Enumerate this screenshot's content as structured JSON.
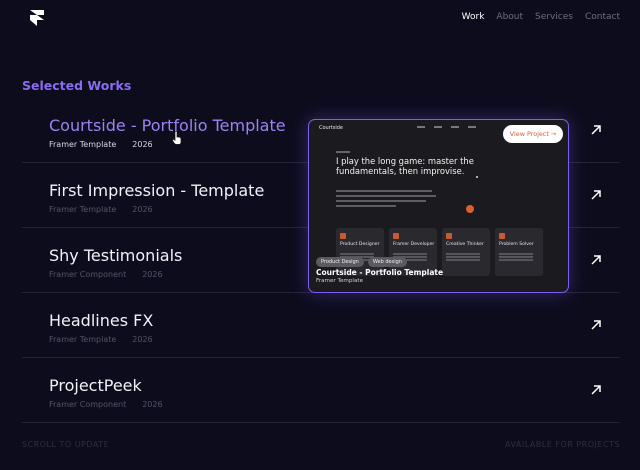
{
  "nav": {
    "items": [
      {
        "label": "Work",
        "active": true
      },
      {
        "label": "About",
        "active": false
      },
      {
        "label": "Services",
        "active": false
      },
      {
        "label": "Contact",
        "active": false
      }
    ]
  },
  "section_title": "Selected Works",
  "works": [
    {
      "title": "Courtside - Portfolio Template",
      "type": "Framer Template",
      "year": "2026",
      "active": true
    },
    {
      "title": "First Impression - Template",
      "type": "Framer Template",
      "year": "2026",
      "active": false
    },
    {
      "title": "Shy Testimonials",
      "type": "Framer Component",
      "year": "2026",
      "active": false
    },
    {
      "title": "Headlines FX",
      "type": "Framer Template",
      "year": "2026",
      "active": false
    },
    {
      "title": "ProjectPeek",
      "type": "Framer Component",
      "year": "2026",
      "active": false
    }
  ],
  "preview": {
    "site_name": "Courtside",
    "headline": "I play the long game: master the fundamentals, then improvise.",
    "cards": [
      "Product Designer",
      "Framer Developer",
      "Creative Thinker",
      "Problem Solver"
    ],
    "view_button": "View Project →",
    "tags": [
      "Product Design",
      "Web design"
    ],
    "caption": "Courtside - Portfolio Template",
    "subcaption": "Framer Template"
  },
  "footer": {
    "left": "SCROLL TO UPDATE",
    "right": "AVAILABLE FOR PROJECTS"
  },
  "colors": {
    "background": "#0d0c1d",
    "accent": "#8b6cf0",
    "active_title": "#9b83f2",
    "preview_orange": "#d9612f"
  }
}
